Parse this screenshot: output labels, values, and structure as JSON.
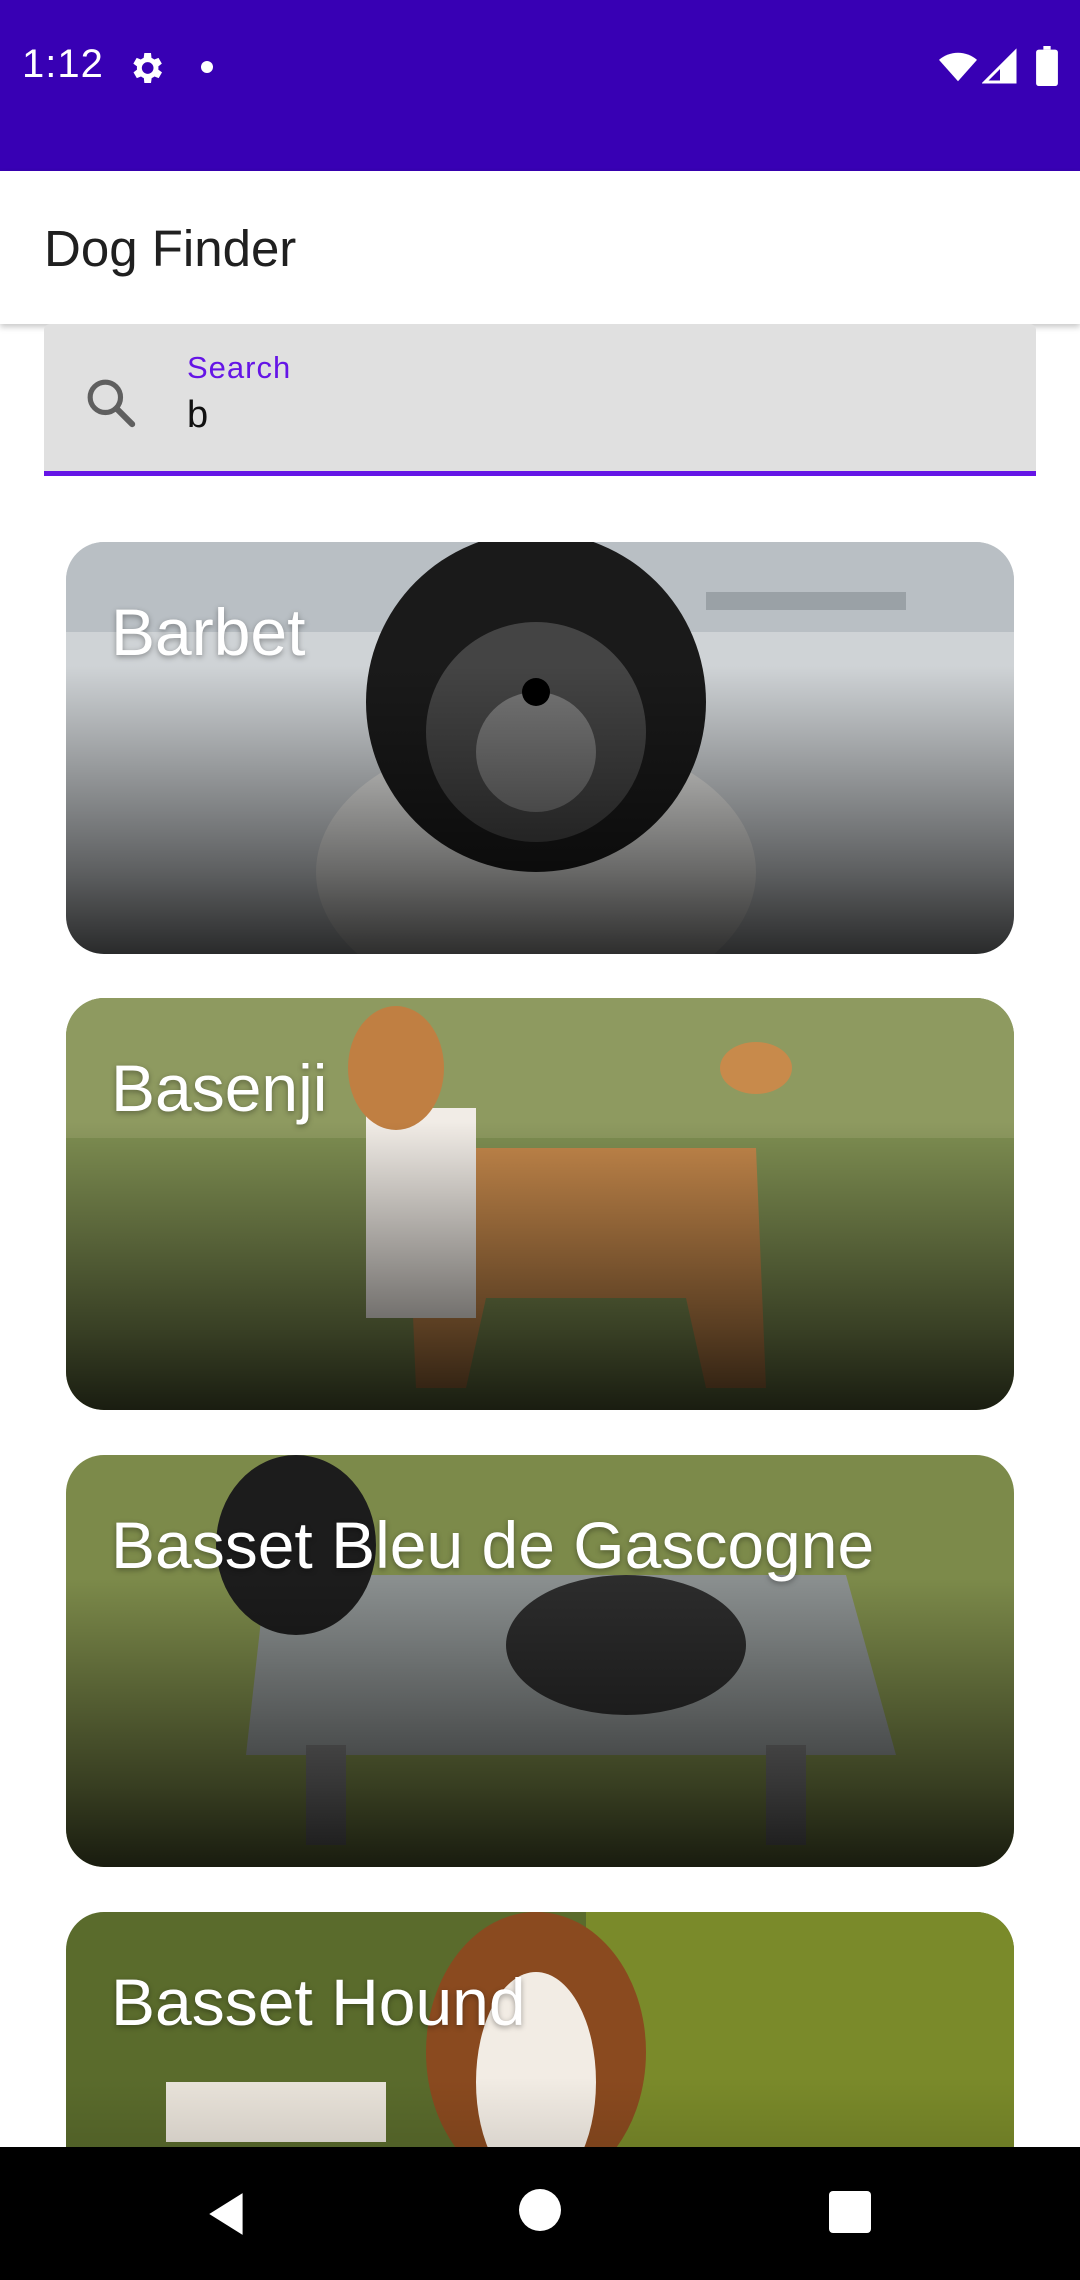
{
  "status_bar": {
    "time": "1:12",
    "icons": [
      "gear-icon",
      "dot-icon",
      "wifi-icon",
      "signal-icon",
      "battery-icon"
    ],
    "background": "#3800b4"
  },
  "app_bar": {
    "title": "Dog Finder"
  },
  "search": {
    "label": "Search",
    "value": "b",
    "accent": "#6515e6",
    "icon": "search-icon"
  },
  "breeds": [
    {
      "name": "Barbet"
    },
    {
      "name": "Basenji"
    },
    {
      "name": "Basset Bleu de Gascogne"
    },
    {
      "name": "Basset Hound"
    }
  ],
  "nav_bar": {
    "buttons": [
      "back-icon",
      "home-icon",
      "recents-icon"
    ]
  }
}
